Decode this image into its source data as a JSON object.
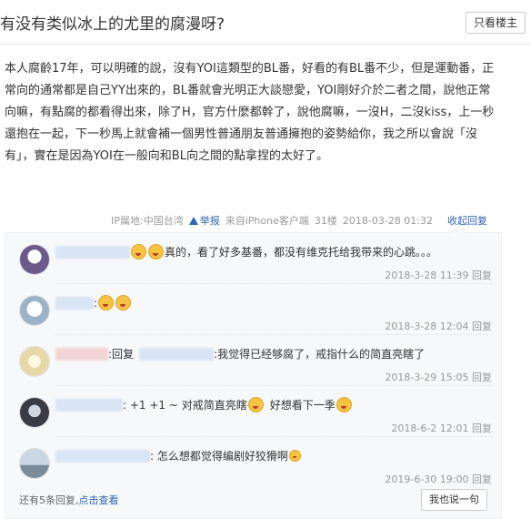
{
  "header": {
    "title": "有没有类似冰上的尤里的腐漫呀?",
    "only_op_label": "只看楼主"
  },
  "post": {
    "body": "本人腐齡17年，可以明確的說，沒有YOI這類型的BL番，好看的有BL番不少，但是運動番，正常向的通常都是自己YY出來的，BL番就會光明正大談戀愛，YOI剛好介於二者之間，說他正常向嘛，有點腐的都看得出來，除了H，官方什麼都幹了，說他腐嘛，一沒H，二沒kiss，上一秒還抱在一起，下一秒馬上就會補一個男性普通朋友普通擁抱的姿勢給你，我之所以會說「沒有」，實在是因為YOI在一般向和BL向之間的點拿捏的太好了。",
    "meta": {
      "ip": "IP属地:中国台湾",
      "report_label": "举报",
      "client": "来自iPhone客户端",
      "floor": "31楼",
      "datetime": "2018-03-28 01:32",
      "collapse_label": "收起回复"
    }
  },
  "replies": [
    {
      "text": "真的，看了好多基番，都没有维克托给我带来的心跳。。。",
      "time": "2018-3-28 11:39",
      "reply_label": "回复",
      "avatar_color": "#6b5a8a"
    },
    {
      "text": ":",
      "time": "2018-3-28 12:04",
      "reply_label": "回复",
      "avatar_color": "#9bb3c9"
    },
    {
      "text_prefix": ":回复",
      "text": ":我觉得已经够腐了，戒指什么的简直亮瞎了",
      "time": "2018-3-29 15:05",
      "reply_label": "回复",
      "avatar_color": "#e8d7a8"
    },
    {
      "text": ": +1 +1 ~ 对戒简直亮瞎",
      "text2": "好想看下一季",
      "time": "2018-6-2 12:01",
      "reply_label": "回复",
      "avatar_color": "#3b3b46"
    },
    {
      "text": ": 怎么想都觉得编剧好狡猾啊",
      "time": "2019-6-30 19:00",
      "reply_label": "回复",
      "avatar_color": "#7a8c9c"
    }
  ],
  "footer": {
    "more_prefix": "还有5条回复,",
    "more_link": "点击查看",
    "say_label": "我也说一句"
  }
}
